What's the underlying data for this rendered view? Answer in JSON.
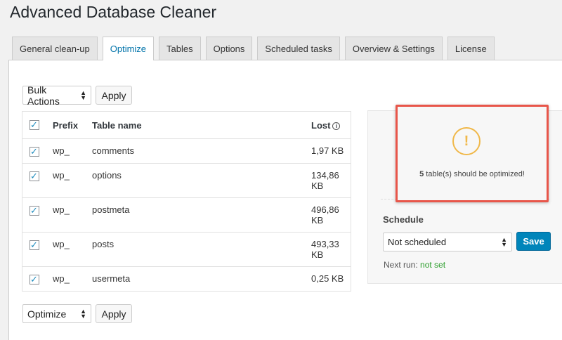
{
  "page": {
    "title": "Advanced Database Cleaner"
  },
  "tabs": [
    {
      "label": "General clean-up"
    },
    {
      "label": "Optimize"
    },
    {
      "label": "Tables"
    },
    {
      "label": "Options"
    },
    {
      "label": "Scheduled tasks"
    },
    {
      "label": "Overview & Settings"
    },
    {
      "label": "License"
    }
  ],
  "bulk": {
    "selected": "Bulk Actions",
    "apply_label": "Apply"
  },
  "bottom_action": {
    "selected": "Optimize",
    "apply_label": "Apply"
  },
  "table": {
    "headers": {
      "prefix": "Prefix",
      "name": "Table name",
      "lost": "Lost"
    },
    "rows": [
      {
        "prefix": "wp_",
        "name": "comments",
        "lost": "1,97 KB"
      },
      {
        "prefix": "wp_",
        "name": "options",
        "lost": "134,86 KB"
      },
      {
        "prefix": "wp_",
        "name": "postmeta",
        "lost": "496,86 KB"
      },
      {
        "prefix": "wp_",
        "name": "posts",
        "lost": "493,33 KB"
      },
      {
        "prefix": "wp_",
        "name": "usermeta",
        "lost": "0,25 KB"
      }
    ]
  },
  "alert": {
    "icon": "exclamation-icon",
    "glyph": "!",
    "count": "5",
    "message": " table(s) should be optimized!"
  },
  "schedule": {
    "label": "Schedule",
    "selected": "Not scheduled",
    "save_label": "Save",
    "next_run_label": "Next run: ",
    "next_run_value": "not set"
  },
  "colors": {
    "accent": "#0073aa",
    "save": "#0085ba",
    "alert_border": "#e8564a",
    "warning": "#f0b849",
    "not_set": "#2a9d2a"
  }
}
